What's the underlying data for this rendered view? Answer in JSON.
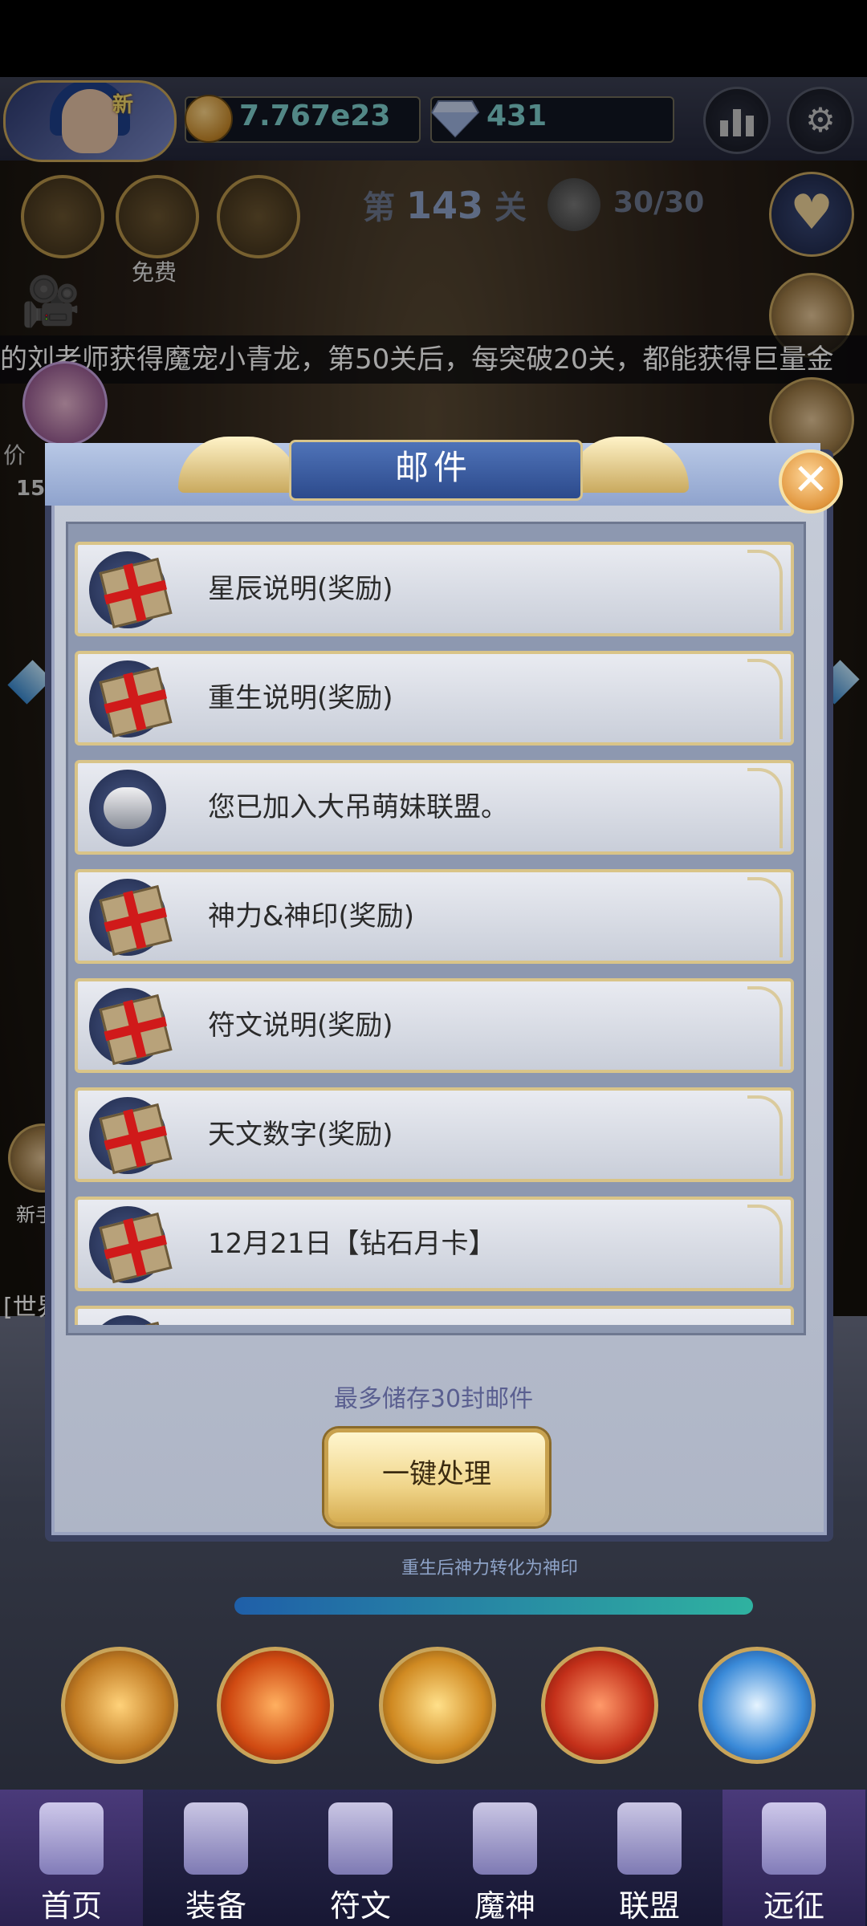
{
  "resources": {
    "gold": "7.767e23",
    "diamonds": "431"
  },
  "avatar": {
    "badge": "新"
  },
  "top_row": {
    "free_label": "免费",
    "stage_prefix": "第",
    "stage_number": "143",
    "stage_suffix": "关",
    "energy": "30/30"
  },
  "ticker": {
    "text": "的刘老师获得魔宠小青龙，第50关后，每突破20关，都能获得巨量金"
  },
  "side_left": {
    "level_fragment": "15",
    "text_fragment": "价",
    "new_fragment": "新手",
    "chat_fragment": "[世界"
  },
  "mail_dialog": {
    "title": "邮件",
    "close_symbol": "✕",
    "items": [
      {
        "title": "星辰说明(奖励)",
        "icon": "gift-box-icon"
      },
      {
        "title": "重生说明(奖励)",
        "icon": "gift-box-icon"
      },
      {
        "title": "您已加入大吊萌妹联盟。",
        "icon": "handshake-icon"
      },
      {
        "title": "神力&神印(奖励)",
        "icon": "gift-box-icon"
      },
      {
        "title": "符文说明(奖励)",
        "icon": "gift-box-icon"
      },
      {
        "title": "天文数字(奖励)",
        "icon": "gift-box-icon"
      },
      {
        "title": "12月21日【钻石月卡】",
        "icon": "gift-box-icon"
      }
    ],
    "note": "最多储存30封邮件",
    "process_button": "一键处理"
  },
  "progress": {
    "caption": "重生后神力转化为神印",
    "fraction": 1.0
  },
  "nav": {
    "items": [
      {
        "label": "首页",
        "active": true
      },
      {
        "label": "装备",
        "active": false
      },
      {
        "label": "符文",
        "active": false
      },
      {
        "label": "魔神",
        "active": false
      },
      {
        "label": "联盟",
        "active": false
      },
      {
        "label": "远征",
        "active": true
      }
    ]
  },
  "colors": {
    "accent_gold": "#c8a45a",
    "resource_text": "#7fd0ce",
    "dialog_title_bg": "#2c4a8c"
  }
}
